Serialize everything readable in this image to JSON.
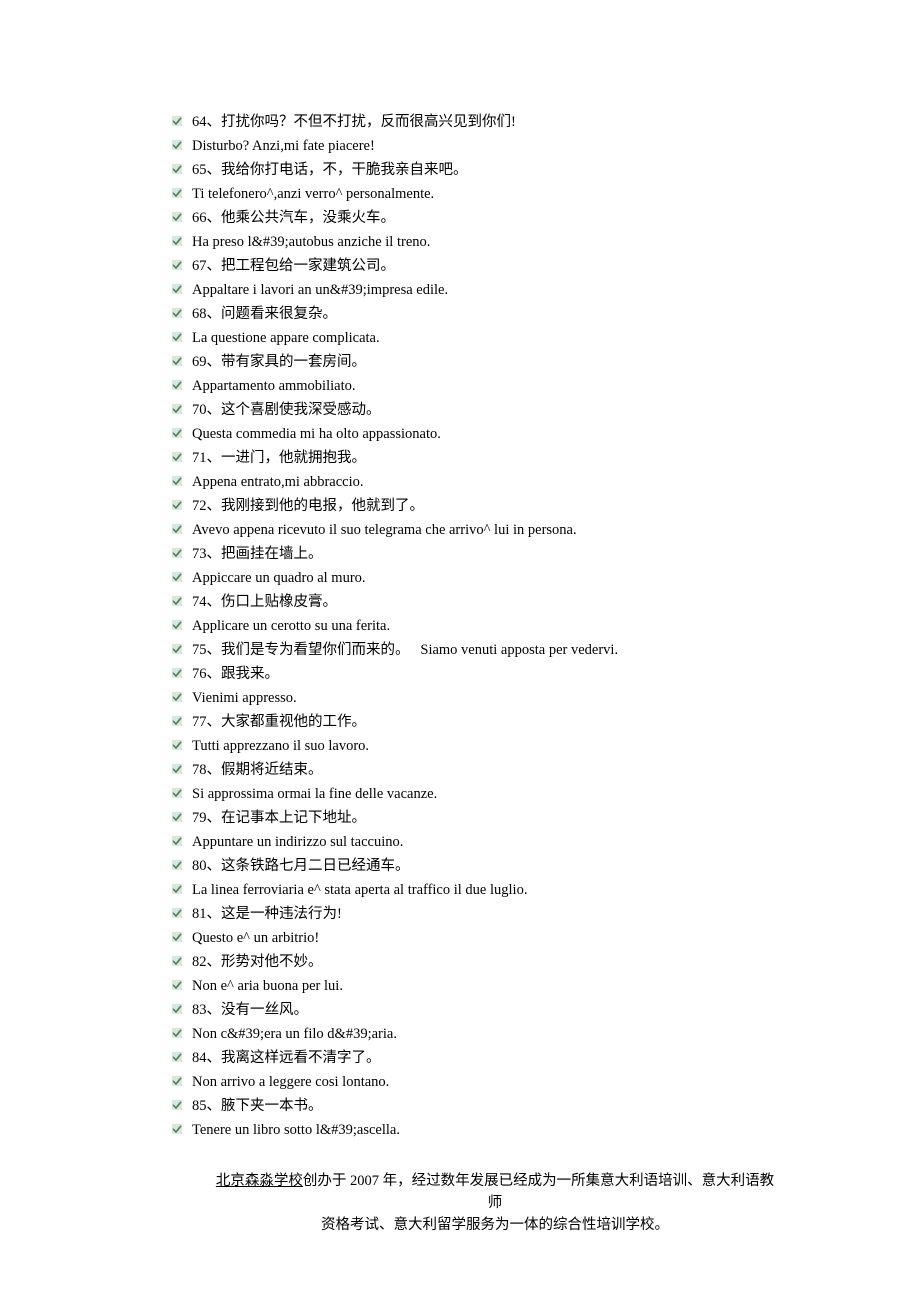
{
  "lines": [
    "64、打扰你吗？不但不打扰，反而很高兴见到你们!",
    "Disturbo? Anzi,mi fate piacere!",
    "65、我给你打电话，不，干脆我亲自来吧。",
    "Ti telefonero^,anzi verro^ personalmente.",
    "66、他乘公共汽车，没乘火车。",
    "Ha preso l&#39;autobus anziche il treno.",
    "67、把工程包给一家建筑公司。",
    "Appaltare i lavori an un&#39;impresa edile.",
    "68、问题看来很复杂。",
    "La questione appare complicata.",
    "69、带有家具的一套房间。",
    "Appartamento ammobiliato.",
    "70、这个喜剧使我深受感动。",
    "Questa commedia mi ha olto appassionato.",
    "71、一进门，他就拥抱我。",
    "Appena entrato,mi abbraccio.",
    "72、我刚接到他的电报，他就到了。",
    "Avevo appena ricevuto il suo telegrama che arrivo^ lui in persona.",
    "73、把画挂在墙上。",
    "Appiccare un quadro al muro.",
    "74、伤口上贴橡皮膏。",
    "Applicare un cerotto su una ferita.",
    "75、我们是专为看望你们而来的。　 Siamo venuti apposta per vedervi.",
    "76、跟我来。",
    "Vienimi appresso.",
    "77、大家都重视他的工作。",
    "Tutti apprezzano il suo lavoro.",
    "78、假期将近结束。",
    "Si approssima ormai la fine delle vacanze.",
    "79、在记事本上记下地址。",
    "Appuntare un indirizzo sul taccuino.",
    "80、这条铁路七月二日已经通车。",
    "La linea ferroviaria e^ stata aperta al traffico il due luglio.",
    "81、这是一种违法行为!",
    "Questo e^ un arbitrio!",
    "82、形势对他不妙。",
    "Non e^ aria buona per lui.",
    "83、没有一丝风。",
    "Non c&#39;era un filo d&#39;aria.",
    "84、我离这样远看不清字了。",
    "Non arrivo a leggere cosi lontano.",
    "85、腋下夹一本书。",
    "Tenere un libro sotto l&#39;ascella."
  ],
  "footer": {
    "underline": "北京森淼学校",
    "rest1": "创办于 2007 年，经过数年发展已经成为一所集意大利语培训、意大利语教师",
    "line2": "资格考试、意大利留学服务为一体的综合性培训学校。"
  }
}
